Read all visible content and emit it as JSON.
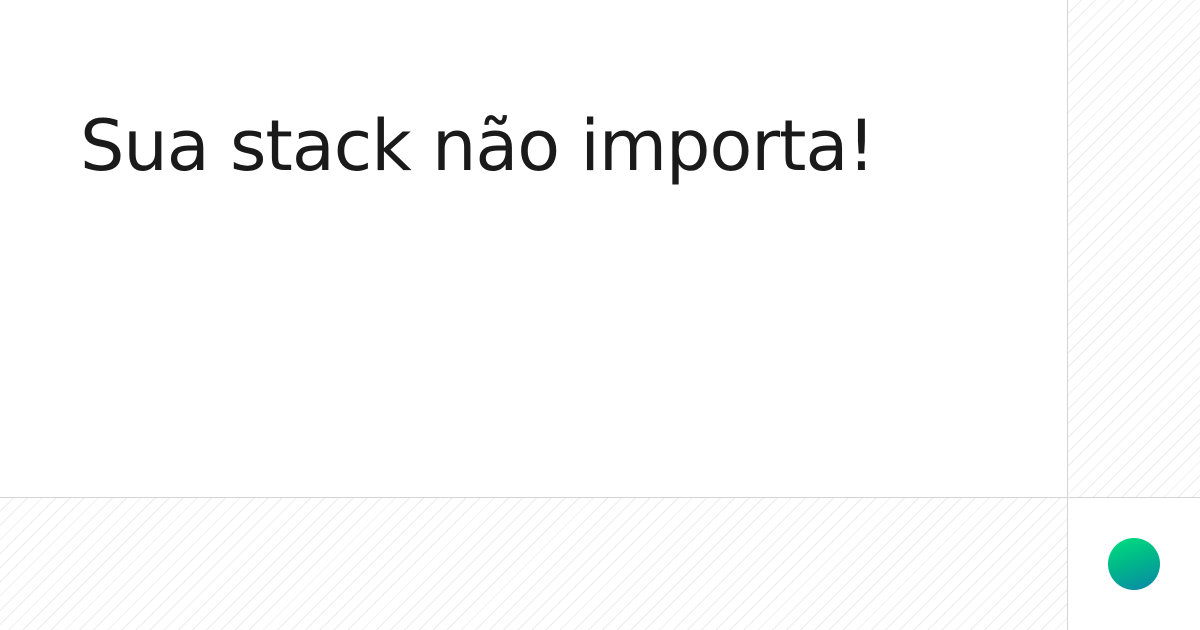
{
  "headline": {
    "text": "Sua stack não importa!"
  },
  "logo": {
    "icon": "gradient-circle-icon",
    "gradient_colors": [
      "#00e07f",
      "#00b889",
      "#0a86a8"
    ]
  },
  "colors": {
    "background": "#ffffff",
    "text": "#1a1a1a",
    "divider": "#d4d4d4",
    "hatch_line": "#ececec"
  }
}
